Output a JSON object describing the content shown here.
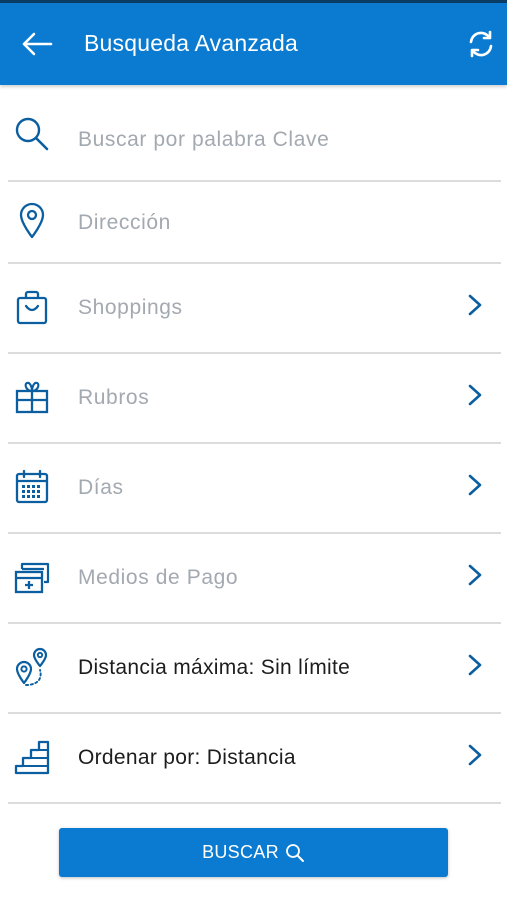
{
  "header": {
    "title": "Busqueda Avanzada",
    "back_icon": "arrow-left-icon",
    "refresh_icon": "refresh-icon",
    "bg_color": "#0a7bd0"
  },
  "fields": {
    "keyword": {
      "placeholder": "Buscar por palabra Clave",
      "icon": "search-icon"
    },
    "address": {
      "placeholder": "Dirección",
      "icon": "location-pin-icon"
    }
  },
  "filters": {
    "shoppings": {
      "label": "Shoppings",
      "icon": "shopping-bag-icon"
    },
    "rubros": {
      "label": "Rubros",
      "icon": "gift-icon"
    },
    "dias": {
      "label": "Días",
      "icon": "calendar-icon"
    },
    "medios_pago": {
      "label": "Medios de Pago",
      "icon": "cards-icon"
    },
    "distancia": {
      "label": "Distancia máxima: Sin límite",
      "icon": "route-pins-icon"
    },
    "ordenar": {
      "label": "Ordenar por: Distancia",
      "icon": "stairs-icon"
    }
  },
  "search_button": {
    "label": "BUSCAR",
    "icon": "search-icon"
  },
  "colors": {
    "accent": "#0a7bd0",
    "icon": "#0b5fa0",
    "placeholder": "#a3a9b0",
    "text": "#1d1d1d"
  }
}
